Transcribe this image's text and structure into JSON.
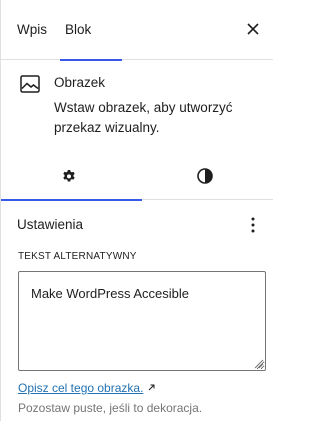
{
  "tabs": {
    "post_label": "Wpis",
    "block_label": "Blok",
    "active": "Blok"
  },
  "block": {
    "icon": "image-icon",
    "title": "Obrazek",
    "description": "Wstaw obrazek, aby utworzyć przekaz wizualny."
  },
  "inspector_tabs": {
    "settings_icon": "gear-icon",
    "styles_icon": "half-circle-icon",
    "active": "settings"
  },
  "panel": {
    "title": "Ustawienia",
    "alt_label": "TEKST ALTERNATYWNY",
    "alt_value": "Make WordPress Accesible",
    "help_link": "Opisz cel tego obrazka.",
    "help_text": "Pozostaw puste, jeśli to dekoracja."
  },
  "colors": {
    "accent": "#3858e9",
    "link": "#2271b1",
    "muted": "#757575"
  }
}
